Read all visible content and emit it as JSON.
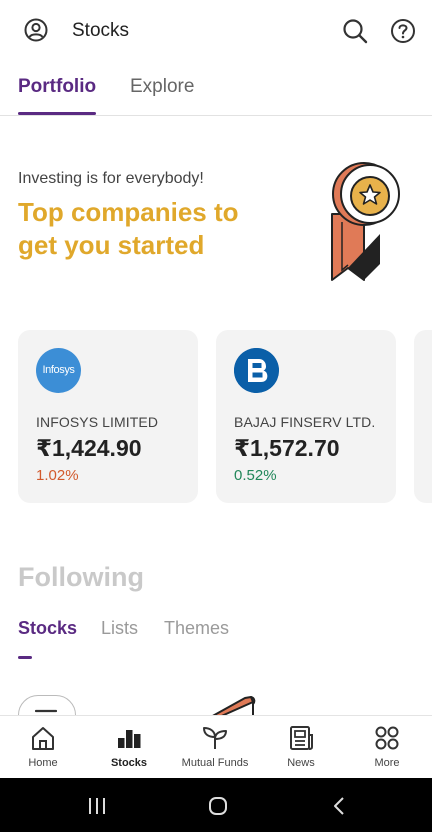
{
  "header": {
    "title": "Stocks",
    "profile_icon": "profile-icon",
    "search_icon": "search-icon",
    "help_icon": "help-icon"
  },
  "tabs": [
    {
      "label": "Portfolio",
      "active": true
    },
    {
      "label": "Explore",
      "active": false
    }
  ],
  "hero": {
    "subtitle": "Investing is for everybody!",
    "headline_line1": "Top companies to",
    "headline_line2": "get you started",
    "headline_color": "#e0a82b",
    "illustration": "badge-ribbon-icon"
  },
  "stock_cards": [
    {
      "logo_text": "Infosys",
      "name": "INFOSYS LIMITED",
      "price": "₹1,424.90",
      "change": "1.02%",
      "change_color": "#d25a2d"
    },
    {
      "logo_text": "",
      "name": "BAJAJ FINSERV LTD.",
      "price": "₹1,572.70",
      "change": "0.52%",
      "change_color": "#22875a"
    }
  ],
  "following": {
    "title": "Following",
    "subtabs": [
      {
        "label": "Stocks",
        "active": true
      },
      {
        "label": "Lists",
        "active": false
      },
      {
        "label": "Themes",
        "active": false
      }
    ]
  },
  "bottom_nav": [
    {
      "label": "Home",
      "icon": "home-icon",
      "active": false
    },
    {
      "label": "Stocks",
      "icon": "bar-chart-icon",
      "active": true
    },
    {
      "label": "Mutual Funds",
      "icon": "sprout-icon",
      "active": false
    },
    {
      "label": "News",
      "icon": "newspaper-icon",
      "active": false
    },
    {
      "label": "More",
      "icon": "grid-icon",
      "active": false
    }
  ],
  "colors": {
    "accent": "#5a2a82",
    "card_bg": "#f3f3f3"
  }
}
